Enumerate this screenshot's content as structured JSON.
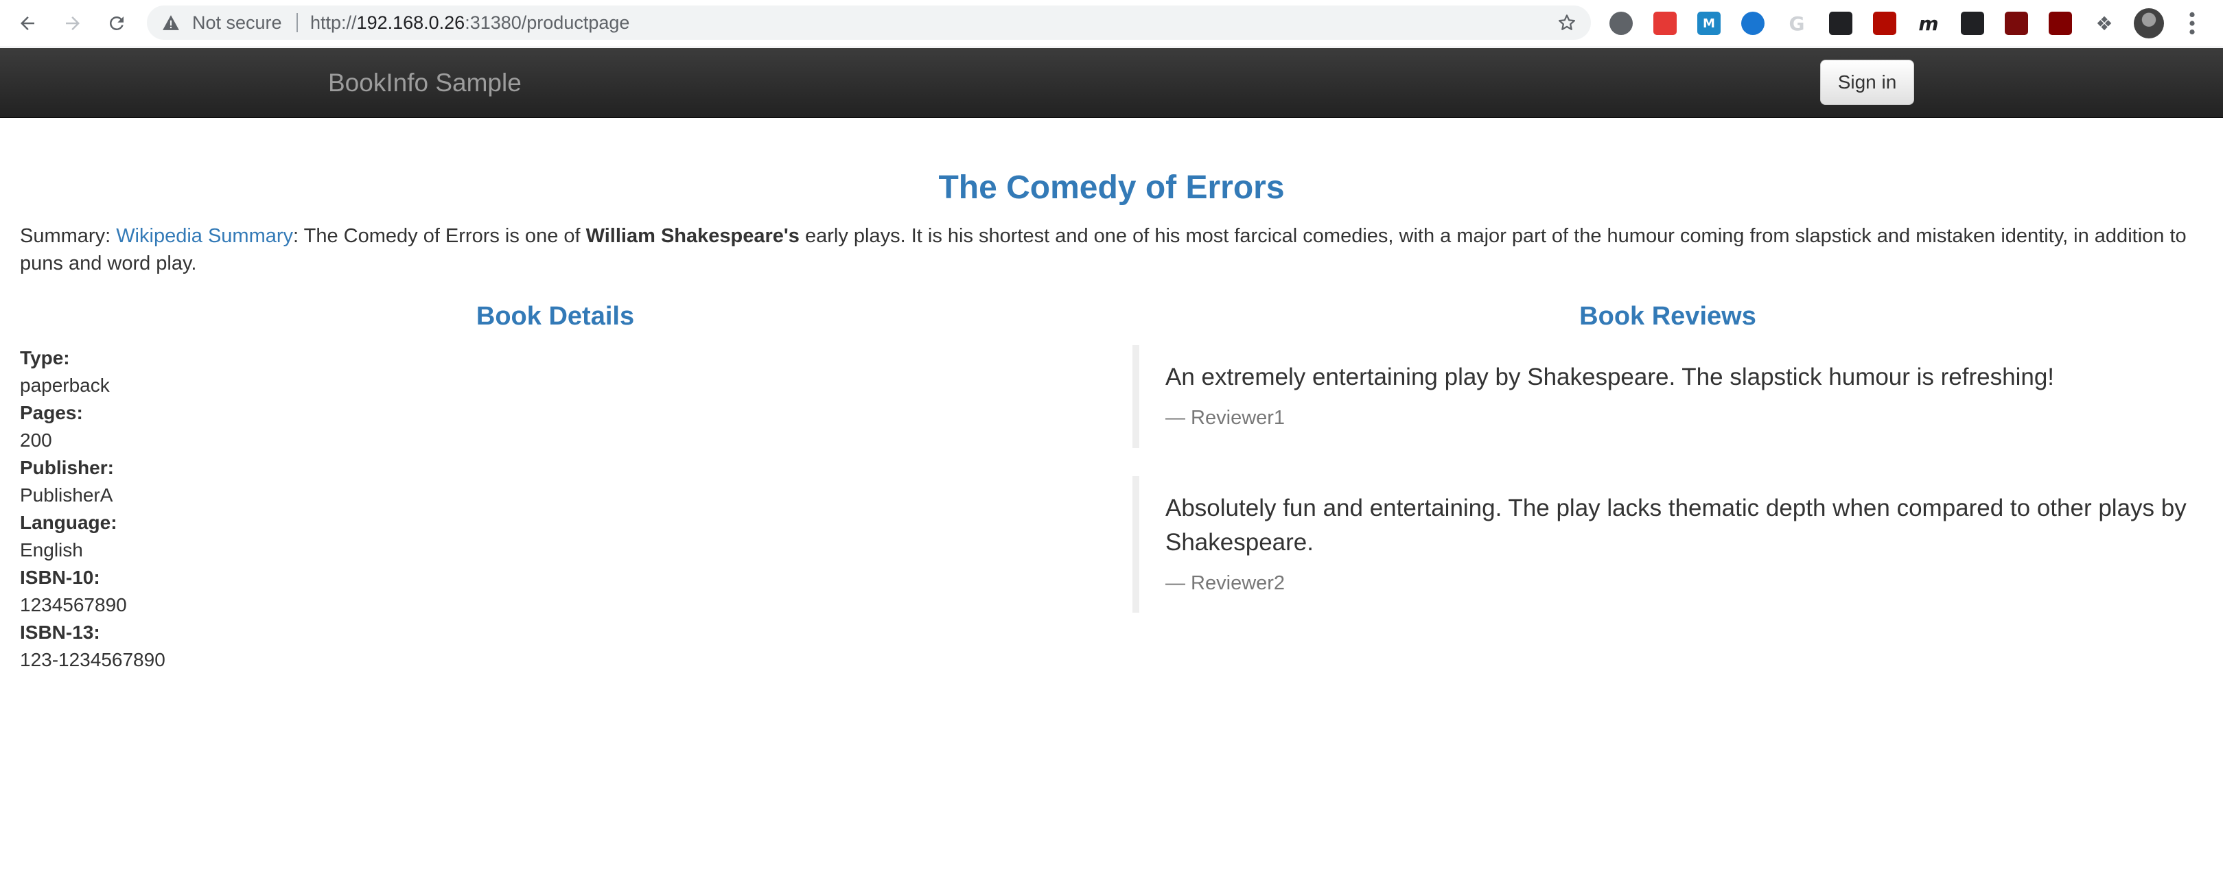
{
  "browser": {
    "security_label": "Not secure",
    "url_prefix": "http://",
    "url_host": "192.168.0.26",
    "url_rest": ":31380/productpage",
    "extensions": [
      {
        "name": "ext-circle-icon",
        "glyph": "",
        "color": "#5f6368"
      },
      {
        "name": "ext-pdf-red-icon",
        "glyph": "",
        "color": "#e53935"
      },
      {
        "name": "ext-m-icon",
        "glyph": "M",
        "color": "#1e88c7"
      },
      {
        "name": "ext-ring-icon",
        "glyph": "",
        "color": "#1976d2"
      },
      {
        "name": "ext-google-icon",
        "glyph": "G",
        "color": "#cfd2d6"
      },
      {
        "name": "ext-qr-icon",
        "glyph": "",
        "color": "#202124"
      },
      {
        "name": "ext-acrobat-icon",
        "glyph": "",
        "color": "#b30b00"
      },
      {
        "name": "ext-m-italic-icon",
        "glyph": "m",
        "color": "#202124"
      },
      {
        "name": "ext-dark-a-icon",
        "glyph": "",
        "color": "#202124"
      },
      {
        "name": "ext-dark-red-icon",
        "glyph": "",
        "color": "#7a0b0b"
      },
      {
        "name": "ext-ublock-icon",
        "glyph": "",
        "color": "#800000"
      },
      {
        "name": "extensions-puzzle-icon",
        "glyph": "",
        "color": "#5f6368"
      }
    ]
  },
  "navbar": {
    "brand": "BookInfo Sample",
    "signin_label": "Sign in"
  },
  "product": {
    "title": "The Comedy of Errors",
    "summary_label": "Summary: ",
    "summary_link": "Wikipedia Summary",
    "summary_text_1": ": The Comedy of Errors is one of ",
    "summary_bold": "William Shakespeare's",
    "summary_text_2": " early plays. It is his shortest and one of his most farcical comedies, with a major part of the humour coming from slapstick and mistaken identity, in addition to puns and word play."
  },
  "details": {
    "heading": "Book Details",
    "items": [
      {
        "label": "Type:",
        "value": "paperback"
      },
      {
        "label": "Pages:",
        "value": "200"
      },
      {
        "label": "Publisher:",
        "value": "PublisherA"
      },
      {
        "label": "Language:",
        "value": "English"
      },
      {
        "label": "ISBN-10:",
        "value": "1234567890"
      },
      {
        "label": "ISBN-13:",
        "value": "123-1234567890"
      }
    ]
  },
  "reviews": {
    "heading": "Book Reviews",
    "items": [
      {
        "text": "An extremely entertaining play by Shakespeare. The slapstick humour is refreshing!",
        "reviewer": "— Reviewer1"
      },
      {
        "text": "Absolutely fun and entertaining. The play lacks thematic depth when compared to other plays by Shakespeare.",
        "reviewer": "— Reviewer2"
      }
    ]
  }
}
